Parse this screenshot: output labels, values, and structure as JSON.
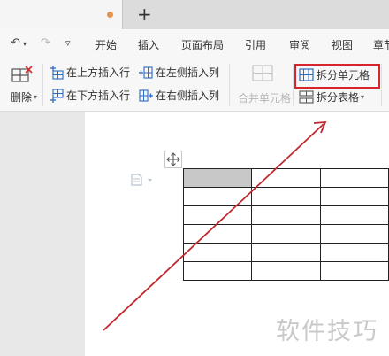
{
  "tabbar": {
    "new_tab_symbol": "+"
  },
  "menu": {
    "items": [
      "开始",
      "插入",
      "页面布局",
      "引用",
      "审阅",
      "视图",
      "章节"
    ]
  },
  "ribbon": {
    "delete_label": "删除",
    "insert_above": "在上方插入行",
    "insert_below": "在下方插入行",
    "insert_left": "在左侧插入列",
    "insert_right": "在右侧插入列",
    "merge_cells": "合并单元格",
    "split_cells": "拆分单元格",
    "split_table": "拆分表格"
  },
  "colors": {
    "highlight": "#d9252a",
    "arrow": "#c0282c",
    "selected_cell": "#c8c8c8"
  },
  "table": {
    "rows": 6,
    "cols": 3,
    "selected_cell": [
      0,
      0
    ]
  },
  "watermark": "软件技巧"
}
